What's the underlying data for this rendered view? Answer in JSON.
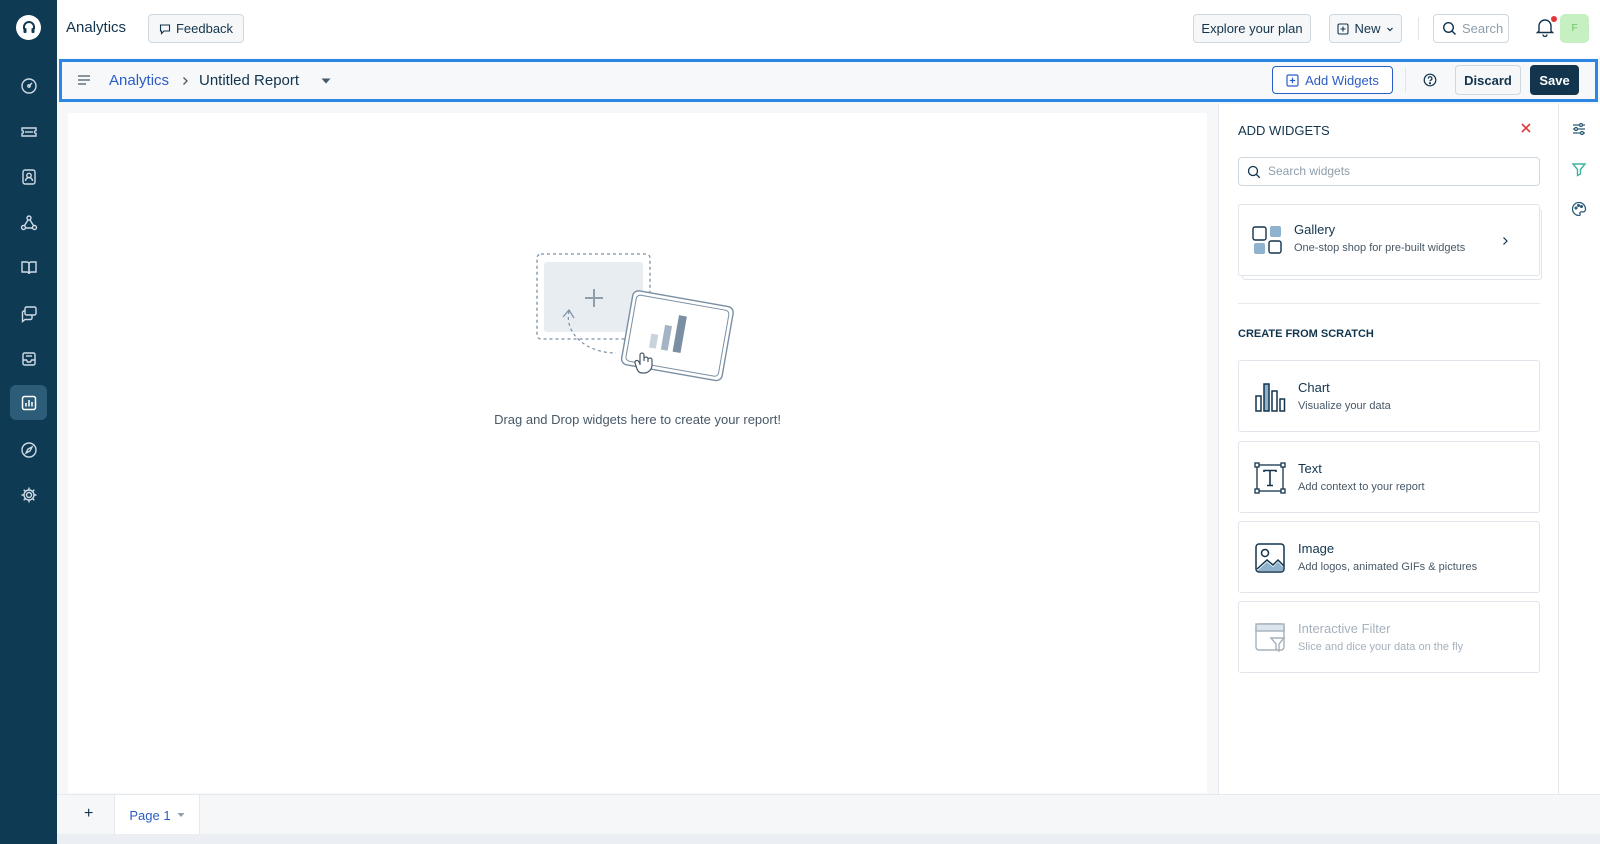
{
  "header": {
    "app_title": "Analytics",
    "feedback_label": "Feedback",
    "explore_label": "Explore your plan",
    "new_label": "New",
    "search_label": "Search",
    "avatar_initial": "F"
  },
  "toolbar": {
    "breadcrumb_parent": "Analytics",
    "report_title": "Untitled Report",
    "add_widgets_label": "Add Widgets",
    "discard_label": "Discard",
    "save_label": "Save"
  },
  "canvas": {
    "empty_message": "Drag and Drop widgets here to create your report!"
  },
  "panel": {
    "title": "ADD WIDGETS",
    "search_placeholder": "Search widgets",
    "gallery": {
      "title": "Gallery",
      "subtitle": "One-stop shop for pre-built widgets"
    },
    "section_label": "CREATE FROM SCRATCH",
    "widgets": [
      {
        "title": "Chart",
        "subtitle": "Visualize your data"
      },
      {
        "title": "Text",
        "subtitle": "Add context to your report"
      },
      {
        "title": "Image",
        "subtitle": "Add logos, animated GIFs & pictures"
      },
      {
        "title": "Interactive Filter",
        "subtitle": "Slice and dice your data on the fly"
      }
    ]
  },
  "footer": {
    "add_page_label": "+",
    "page_tab_label": "Page 1"
  },
  "colors": {
    "sidebar_bg": "#0f3a54",
    "accent_blue": "#2c5cc5",
    "primary_dark": "#12344d",
    "toolbar_highlight": "#2c86e4",
    "close_red": "#e43538"
  },
  "icons": {
    "sidebar": [
      "dashboard-icon",
      "tickets-icon",
      "contacts-icon",
      "groups-icon",
      "solutions-icon",
      "conversations-icon",
      "inbox-icon",
      "analytics-icon",
      "discover-icon",
      "settings-icon"
    ],
    "rail": [
      "sliders-icon",
      "filter-icon",
      "palette-icon"
    ]
  }
}
